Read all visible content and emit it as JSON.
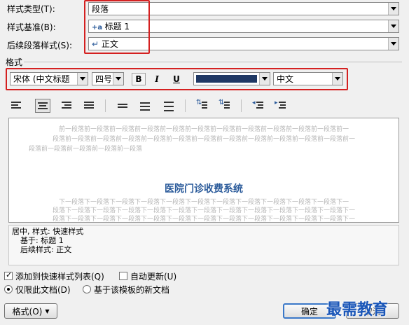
{
  "style_type": {
    "label": "样式类型(T):",
    "value": "段落"
  },
  "style_based_on": {
    "label": "样式基准(B):",
    "value": "标题 1"
  },
  "next_style": {
    "label": "后续段落样式(S):",
    "value": "正文"
  },
  "format_section": {
    "label": "格式"
  },
  "font": {
    "value": "宋体 (中文标题"
  },
  "size": {
    "value": "四号"
  },
  "bold_label": "B",
  "italic_label": "I",
  "underline_label": "U",
  "font_color": "#1f3864",
  "script": {
    "value": "中文"
  },
  "preview": {
    "prev_para": [
      "前一段落前一段落前一段落前一段落前一段落前一段落前一段落前一段落前一段落前一段落前一段落前一",
      "段落前一段落前一段落前一段落前一段落前一段落前一段落前一段落前一段落前一段落前一段落前一段落前一",
      "段落前一段落前一段落前一段落前一段落"
    ],
    "title": "医院门诊收费系统",
    "next_para": [
      "下一段落下一段落下一段落下一段落下一段落下一段落下一段落下一段落下一段落下一段落下一段落下一",
      "段落下一段落下一段落下一段落下一段落下一段落下一段落下一段落下一段落下一段落下一段落下一段落下一",
      "段落下一段落下一段落下一段落下一段落下一段落下一段落下一段落下一段落下一段落下一段落下一段落下一"
    ]
  },
  "description": {
    "line1": "居中, 样式: 快速样式",
    "line2": "基于: 标题 1",
    "line3": "后续样式: 正文"
  },
  "options": {
    "add_quick": "添加到快速样式列表(Q)",
    "auto_update": "自动更新(U)",
    "this_doc": "仅限此文档(D)",
    "template": "基于该模板的新文档"
  },
  "buttons": {
    "format": "格式(O)",
    "ok": "确定",
    "cancel": "取消"
  },
  "watermark": "最需教育"
}
